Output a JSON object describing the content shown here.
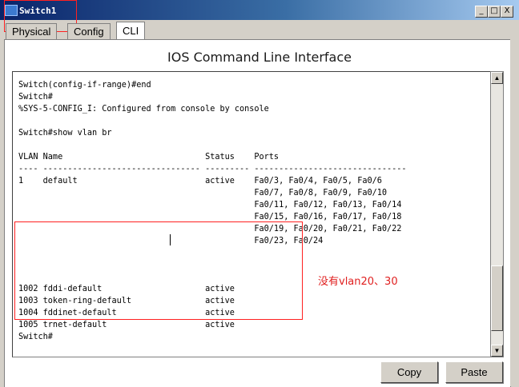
{
  "window": {
    "title": "Switch1",
    "minimize": "_",
    "restore": "□",
    "close": "X"
  },
  "tabs": [
    {
      "label": "Physical"
    },
    {
      "label": "Config"
    },
    {
      "label": "CLI"
    }
  ],
  "heading": "IOS Command Line Interface",
  "terminal": {
    "lines": [
      "Switch(config-if-range)#end",
      "Switch#",
      "%SYS-5-CONFIG_I: Configured from console by console",
      "",
      "Switch#show vlan br",
      "",
      "VLAN Name                             Status    Ports",
      "---- -------------------------------- --------- -------------------------------",
      "1    default                          active    Fa0/3, Fa0/4, Fa0/5, Fa0/6",
      "                                                Fa0/7, Fa0/8, Fa0/9, Fa0/10",
      "                                                Fa0/11, Fa0/12, Fa0/13, Fa0/14",
      "                                                Fa0/15, Fa0/16, Fa0/17, Fa0/18",
      "                                                Fa0/19, Fa0/20, Fa0/21, Fa0/22",
      "                                                Fa0/23, Fa0/24",
      "1002 fddi-default                     active",
      "1003 token-ring-default               active",
      "1004 fddinet-default                  active",
      "1005 trnet-default                    active",
      "Switch#"
    ]
  },
  "annotation": "没有vlan20、30",
  "buttons": {
    "copy": "Copy",
    "paste": "Paste"
  },
  "scrollbar": {
    "up": "▲",
    "down": "▼"
  },
  "colors": {
    "annotation": "#e02020",
    "highlight_box": "#ff2020"
  }
}
